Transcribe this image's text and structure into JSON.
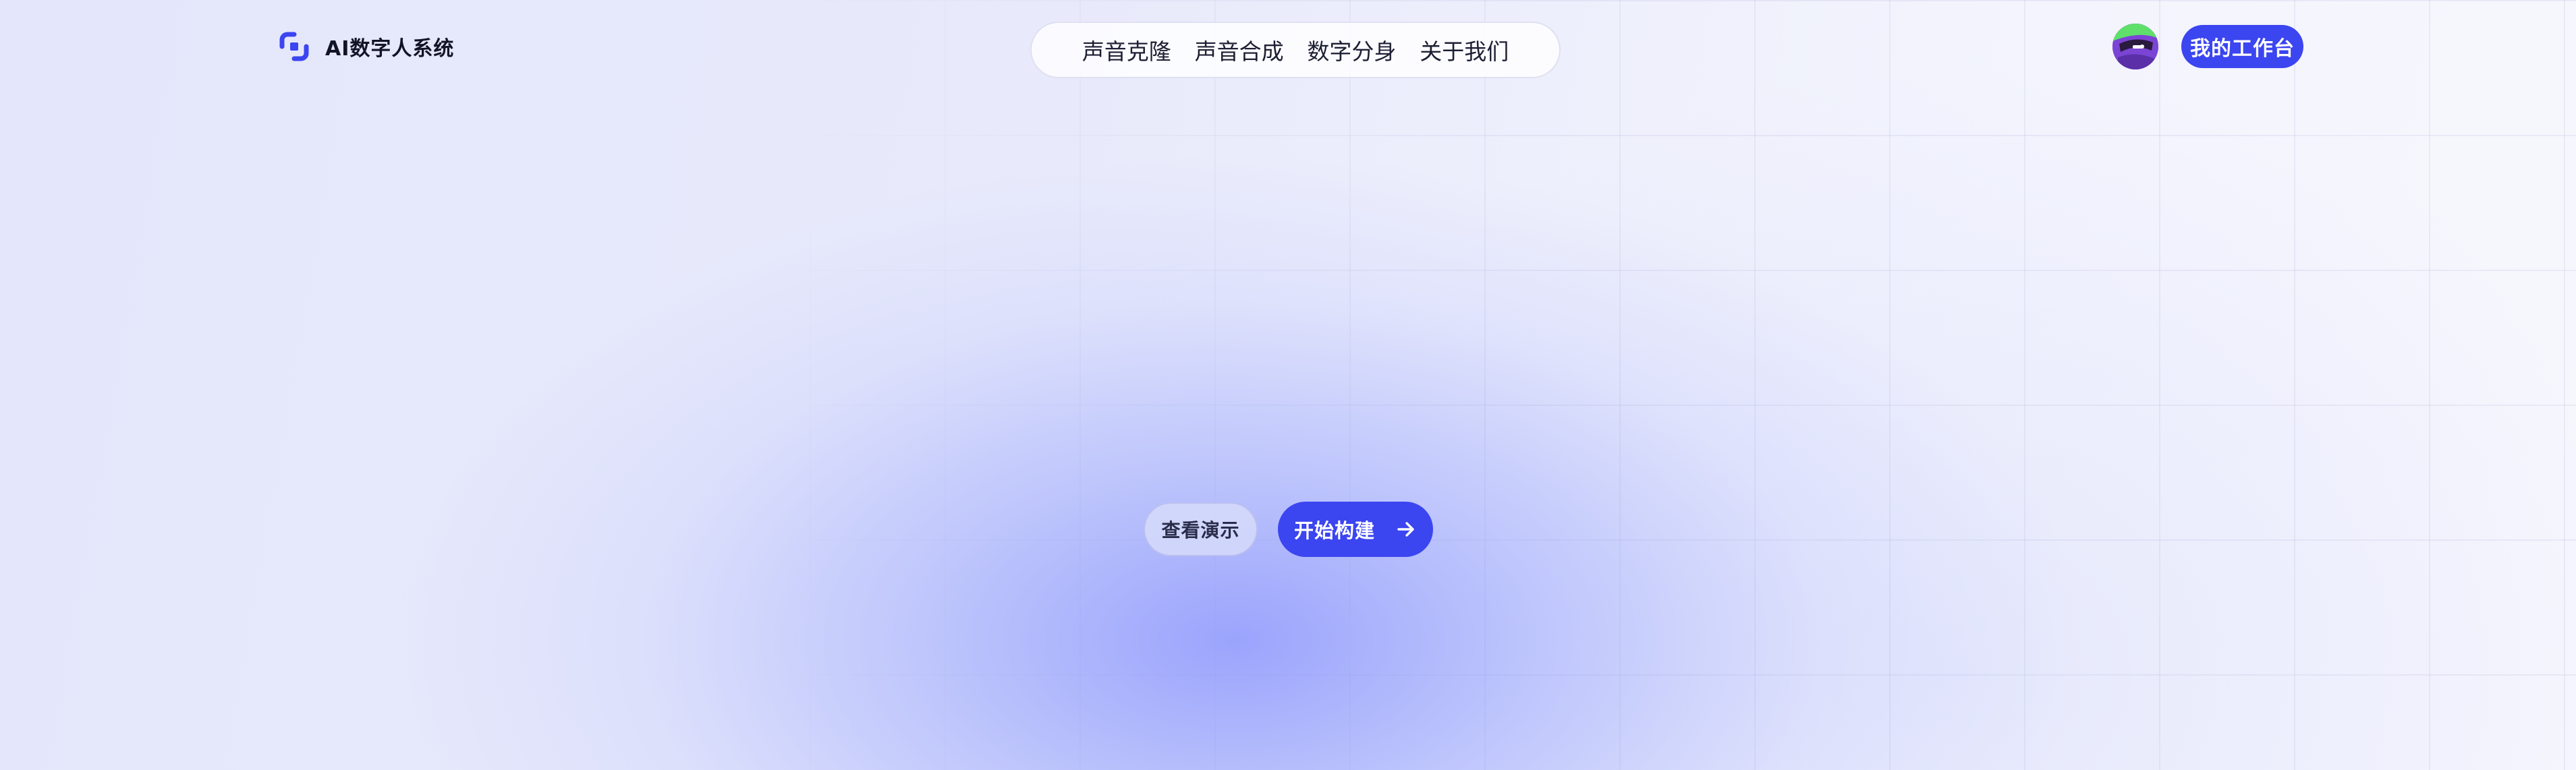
{
  "brand": {
    "name": "AI数字人系统",
    "logo_icon": "bracket-logo-icon",
    "accent_color": "#3b45f0"
  },
  "nav": {
    "items": [
      {
        "label": "声音克隆"
      },
      {
        "label": "声音合成"
      },
      {
        "label": "数字分身"
      },
      {
        "label": "关于我们"
      }
    ]
  },
  "user": {
    "avatar_icon": "avatar-icon",
    "workbench_label": "我的工作台"
  },
  "hero": {
    "demo_label": "查看演示",
    "start_label": "开始构建",
    "start_icon": "arrow-right-icon"
  },
  "colors": {
    "primary": "#3b45f0",
    "background": "#eceefc",
    "glow": "#a7aefc"
  }
}
